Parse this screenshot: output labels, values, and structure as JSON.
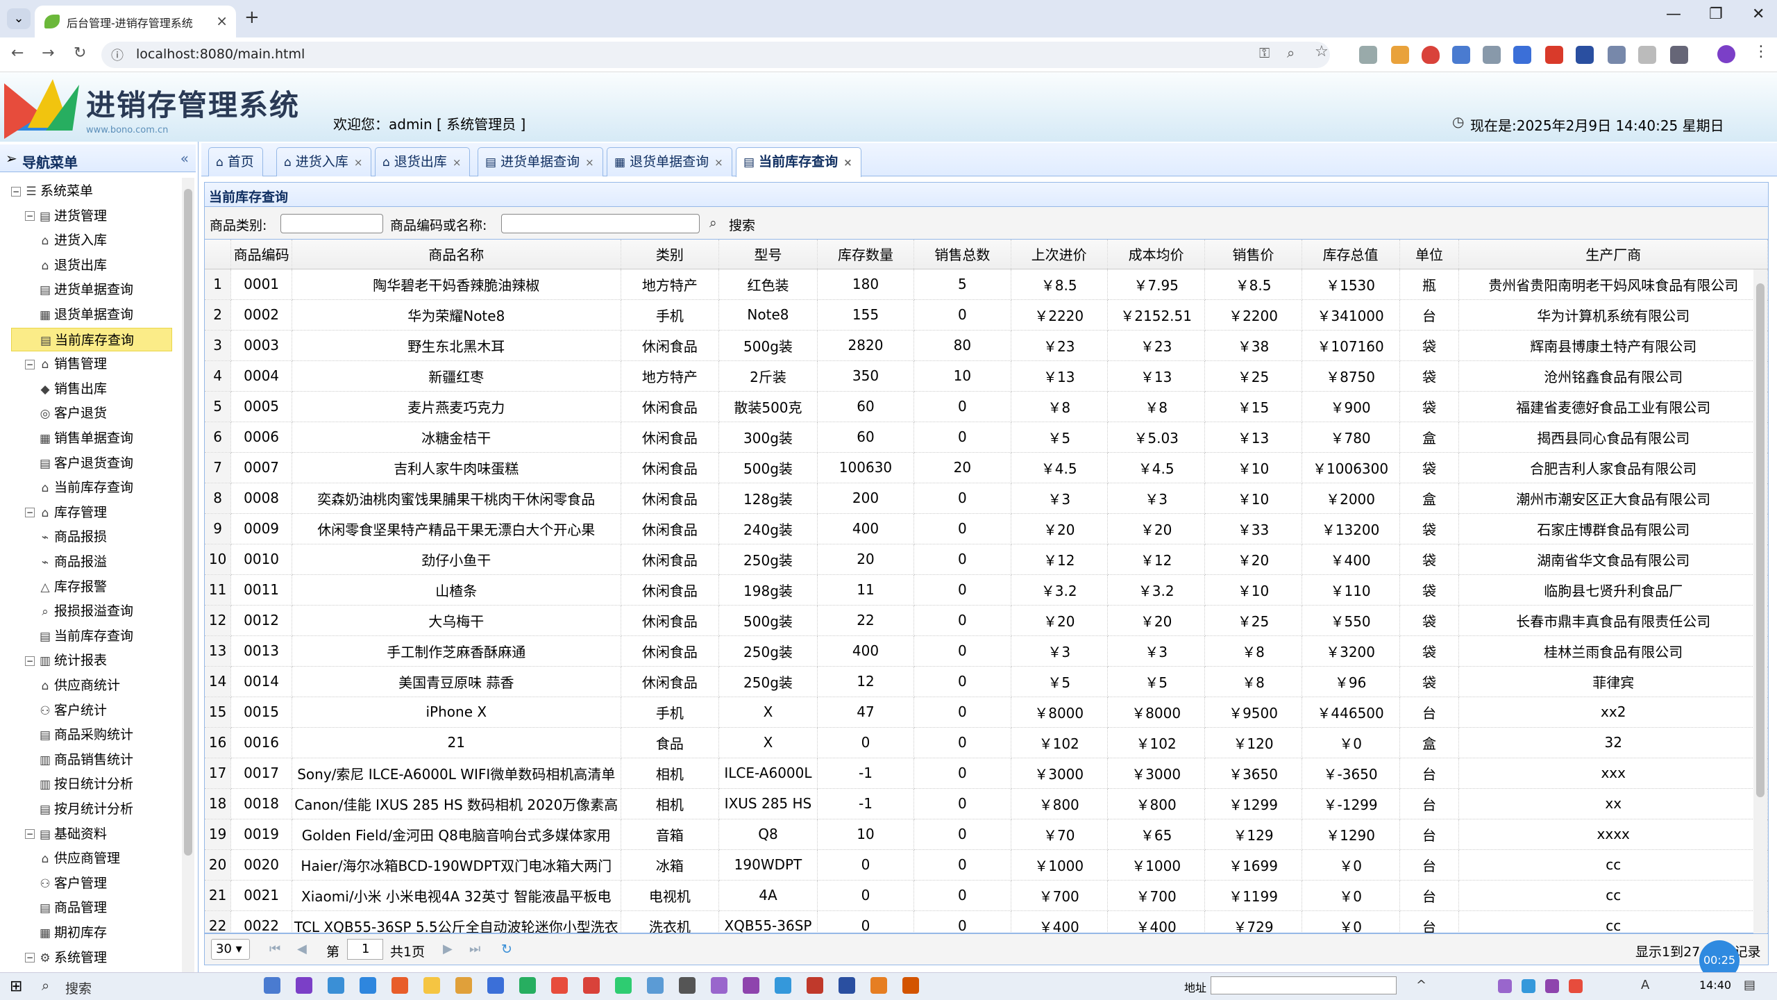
{
  "browser": {
    "tab_title": "后台管理-进销存管理系统",
    "url": "localhost:8080/main.html"
  },
  "header": {
    "app_title": "进销存管理系统",
    "app_sub": "www.bono.com.cn",
    "welcome": "欢迎您：admin [ 系统管理员 ]",
    "now": "现在是:2025年2月9日 14:40:25 星期日"
  },
  "sidebar": {
    "title": "导航菜单",
    "collapse": "«",
    "root": "系统菜单",
    "groups": [
      {
        "label": "进货管理",
        "items": [
          "进货入库",
          "退货出库",
          "进货单据查询",
          "退货单据查询",
          "当前库存查询"
        ]
      },
      {
        "label": "销售管理",
        "items": [
          "销售出库",
          "客户退货",
          "销售单据查询",
          "客户退货查询",
          "当前库存查询"
        ]
      },
      {
        "label": "库存管理",
        "items": [
          "商品报损",
          "商品报溢",
          "库存报警",
          "报损报溢查询",
          "当前库存查询"
        ]
      },
      {
        "label": "统计报表",
        "items": [
          "供应商统计",
          "客户统计",
          "商品采购统计",
          "商品销售统计",
          "按日统计分析",
          "按月统计分析"
        ]
      },
      {
        "label": "基础资料",
        "items": [
          "供应商管理",
          "客户管理",
          "商品管理",
          "期初库存"
        ]
      },
      {
        "label": "系统管理",
        "items": []
      }
    ]
  },
  "tabs": [
    {
      "label": "首页",
      "closable": false
    },
    {
      "label": "进货入库",
      "closable": true
    },
    {
      "label": "退货出库",
      "closable": true
    },
    {
      "label": "进货单据查询",
      "closable": true
    },
    {
      "label": "退货单据查询",
      "closable": true
    },
    {
      "label": "当前库存查询",
      "closable": true,
      "active": true
    }
  ],
  "panel": {
    "title": "当前库存查询",
    "category_label": "商品类别:",
    "code_label": "商品编码或名称:",
    "search_label": "搜索"
  },
  "grid": {
    "columns": [
      "商品编码",
      "商品名称",
      "类别",
      "型号",
      "库存数量",
      "销售总数",
      "上次进价",
      "成本均价",
      "销售价",
      "库存总值",
      "单位",
      "生产厂商"
    ],
    "rows": [
      [
        "1",
        "0001",
        "陶华碧老干妈香辣脆油辣椒",
        "地方特产",
        "红色装",
        "180",
        "5",
        "￥8.5",
        "￥7.95",
        "￥8.5",
        "￥1530",
        "瓶",
        "贵州省贵阳南明老干妈风味食品有限公司"
      ],
      [
        "2",
        "0002",
        "华为荣耀Note8",
        "手机",
        "Note8",
        "155",
        "0",
        "￥2220",
        "￥2152.51",
        "￥2200",
        "￥341000",
        "台",
        "华为计算机系统有限公司"
      ],
      [
        "3",
        "0003",
        "野生东北黑木耳",
        "休闲食品",
        "500g装",
        "2820",
        "80",
        "￥23",
        "￥23",
        "￥38",
        "￥107160",
        "袋",
        "辉南县博康土特产有限公司"
      ],
      [
        "4",
        "0004",
        "新疆红枣",
        "地方特产",
        "2斤装",
        "350",
        "10",
        "￥13",
        "￥13",
        "￥25",
        "￥8750",
        "袋",
        "沧州铭鑫食品有限公司"
      ],
      [
        "5",
        "0005",
        "麦片燕麦巧克力",
        "休闲食品",
        "散装500克",
        "60",
        "0",
        "￥8",
        "￥8",
        "￥15",
        "￥900",
        "袋",
        "福建省麦德好食品工业有限公司"
      ],
      [
        "6",
        "0006",
        "冰糖金桔干",
        "休闲食品",
        "300g装",
        "60",
        "0",
        "￥5",
        "￥5.03",
        "￥13",
        "￥780",
        "盒",
        "揭西县同心食品有限公司"
      ],
      [
        "7",
        "0007",
        "吉利人家牛肉味蛋糕",
        "休闲食品",
        "500g装",
        "100630",
        "20",
        "￥4.5",
        "￥4.5",
        "￥10",
        "￥1006300",
        "袋",
        "合肥吉利人家食品有限公司"
      ],
      [
        "8",
        "0008",
        "奕森奶油桃肉蜜饯果脯果干桃肉干休闲零食品",
        "休闲食品",
        "128g装",
        "200",
        "0",
        "￥3",
        "￥3",
        "￥10",
        "￥2000",
        "盒",
        "潮州市潮安区正大食品有限公司"
      ],
      [
        "9",
        "0009",
        "休闲零食坚果特产精品干果无漂白大个开心果",
        "休闲食品",
        "240g装",
        "400",
        "0",
        "￥20",
        "￥20",
        "￥33",
        "￥13200",
        "袋",
        "石家庄博群食品有限公司"
      ],
      [
        "10",
        "0010",
        "劲仔小鱼干",
        "休闲食品",
        "250g装",
        "20",
        "0",
        "￥12",
        "￥12",
        "￥20",
        "￥400",
        "袋",
        "湖南省华文食品有限公司"
      ],
      [
        "11",
        "0011",
        "山楂条",
        "休闲食品",
        "198g装",
        "11",
        "0",
        "￥3.2",
        "￥3.2",
        "￥10",
        "￥110",
        "袋",
        "临朐县七贤升利食品厂"
      ],
      [
        "12",
        "0012",
        "大乌梅干",
        "休闲食品",
        "500g装",
        "22",
        "0",
        "￥20",
        "￥20",
        "￥25",
        "￥550",
        "袋",
        "长春市鼎丰真食品有限责任公司"
      ],
      [
        "13",
        "0013",
        "手工制作芝麻香酥麻通",
        "休闲食品",
        "250g装",
        "400",
        "0",
        "￥3",
        "￥3",
        "￥8",
        "￥3200",
        "袋",
        "桂林兰雨食品有限公司"
      ],
      [
        "14",
        "0014",
        "美国青豆原味 蒜香",
        "休闲食品",
        "250g装",
        "12",
        "0",
        "￥5",
        "￥5",
        "￥8",
        "￥96",
        "袋",
        "菲律宾"
      ],
      [
        "15",
        "0015",
        "iPhone X",
        "手机",
        "X",
        "47",
        "0",
        "￥8000",
        "￥8000",
        "￥9500",
        "￥446500",
        "台",
        "xx2"
      ],
      [
        "16",
        "0016",
        "21",
        "食品",
        "X",
        "0",
        "0",
        "￥102",
        "￥102",
        "￥120",
        "￥0",
        "盒",
        "32"
      ],
      [
        "17",
        "0017",
        "Sony/索尼 ILCE-A6000L WIFI微单数码相机高清单",
        "相机",
        "ILCE-A6000L",
        "-1",
        "0",
        "￥3000",
        "￥3000",
        "￥3650",
        "￥-3650",
        "台",
        "xxx"
      ],
      [
        "18",
        "0018",
        "Canon/佳能 IXUS 285 HS 数码相机 2020万像素高",
        "相机",
        "IXUS 285 HS",
        "-1",
        "0",
        "￥800",
        "￥800",
        "￥1299",
        "￥-1299",
        "台",
        "xx"
      ],
      [
        "19",
        "0019",
        "Golden Field/金河田 Q8电脑音响台式多媒体家用",
        "音箱",
        "Q8",
        "10",
        "0",
        "￥70",
        "￥65",
        "￥129",
        "￥1290",
        "台",
        "xxxx"
      ],
      [
        "20",
        "0020",
        "Haier/海尔冰箱BCD-190WDPT双门电冰箱大两门",
        "冰箱",
        "190WDPT",
        "0",
        "0",
        "￥1000",
        "￥1000",
        "￥1699",
        "￥0",
        "台",
        "cc"
      ],
      [
        "21",
        "0021",
        "Xiaomi/小米 小米电视4A 32英寸 智能液晶平板电",
        "电视机",
        "4A",
        "0",
        "0",
        "￥700",
        "￥700",
        "￥1199",
        "￥0",
        "台",
        "cc"
      ],
      [
        "22",
        "0022",
        "TCL XQB55-36SP 5.5公斤全自动波轮迷你小型洗衣",
        "洗衣机",
        "XQB55-36SP",
        "0",
        "0",
        "￥400",
        "￥400",
        "￥729",
        "￥0",
        "台",
        "cc"
      ]
    ]
  },
  "pager": {
    "page_size": "30",
    "page_label": "第",
    "page_value": "1",
    "total_pages": "共1页",
    "info": "显示1到27,共27记录"
  },
  "timer": "00:25",
  "taskbar": {
    "search": "搜索",
    "address": "地址",
    "clock": "14:40"
  },
  "colors": {
    "accent": "#95b8e7",
    "tab_bg": "#e0ecff",
    "selected": "#fbec88",
    "taskbar": "#e8eef6"
  }
}
